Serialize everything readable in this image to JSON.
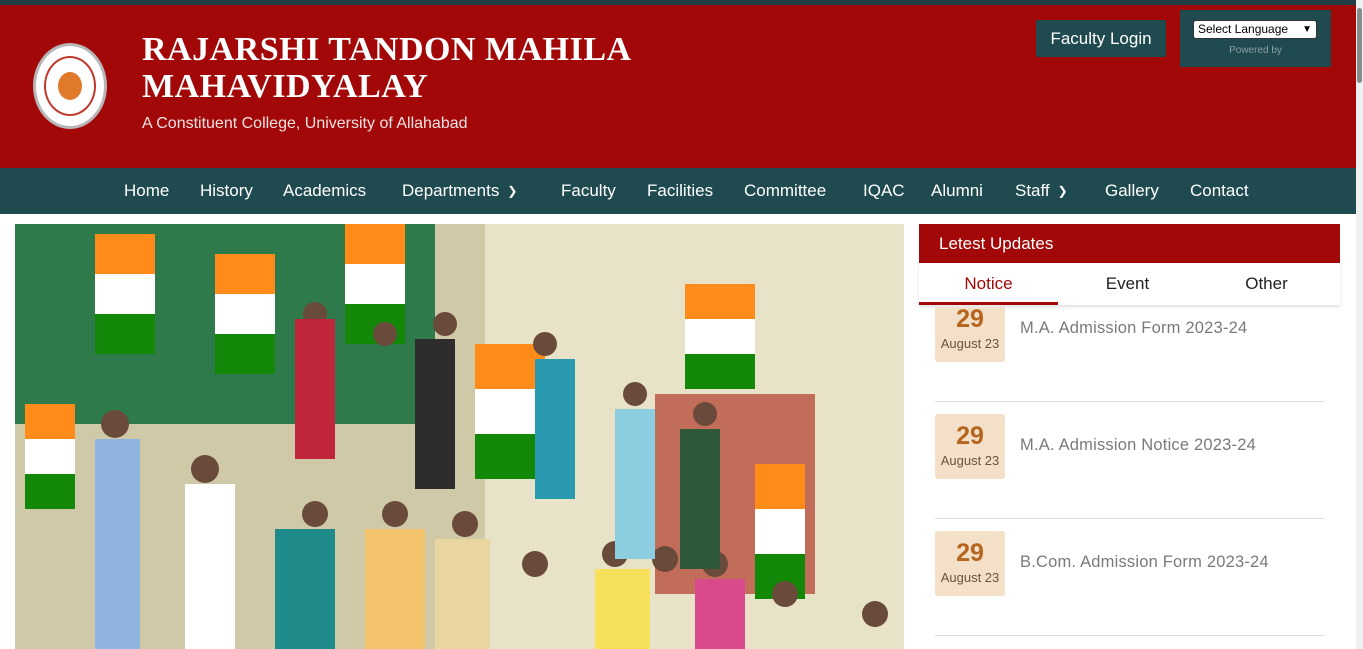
{
  "header": {
    "title_line1": "RAJARSHI TANDON MAHILA",
    "title_line2": "MAHAVIDYALAY",
    "subtitle": "A Constituent College, University of Allahabad",
    "faculty_login": "Faculty Login",
    "language_select": "Select Language",
    "powered_by": "Powered by"
  },
  "nav": {
    "items": [
      "Home",
      "History",
      "Academics",
      "Departments",
      "Faculty",
      "Facilities",
      "Committee",
      "IQAC",
      "Alumni",
      "Staff",
      "Gallery",
      "Contact"
    ]
  },
  "updates": {
    "heading": "Letest Updates",
    "tabs": [
      "Notice",
      "Event",
      "Other"
    ],
    "active_tab": "Notice",
    "notices": [
      {
        "day": "29",
        "month": "August 23",
        "title": "M.A. Admission Form 2023-24"
      },
      {
        "day": "29",
        "month": "August 23",
        "title": "M.A. Admission Notice 2023-24"
      },
      {
        "day": "29",
        "month": "August 23",
        "title": "B.Com. Admission Form 2023-24"
      }
    ]
  },
  "colors": {
    "brand_red": "#a30808",
    "nav_teal": "#1f4a50",
    "date_bg": "#f4dfc8",
    "date_text": "#b5651d"
  },
  "icons": {
    "dropdown": "chevron-down-icon",
    "logo": "college-emblem"
  }
}
